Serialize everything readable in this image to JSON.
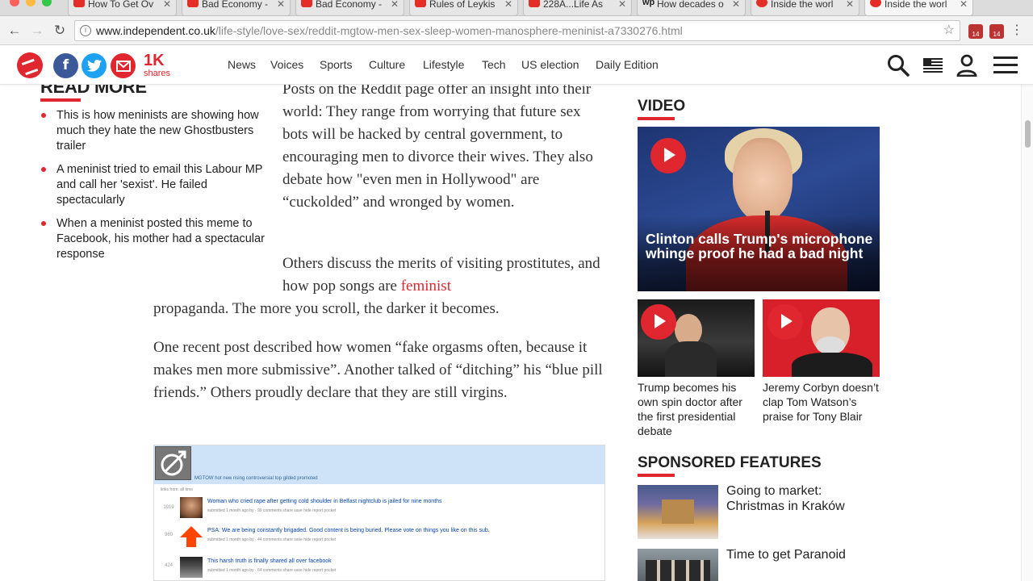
{
  "browser": {
    "tabs": [
      {
        "title": "How To Get Ov",
        "icon": "youtube-icon"
      },
      {
        "title": "Bad Economy -",
        "icon": "youtube-icon"
      },
      {
        "title": "Bad Economy -",
        "icon": "youtube-icon"
      },
      {
        "title": "Rules of Leykis",
        "icon": "youtube-icon"
      },
      {
        "title": "228A...Life As",
        "icon": "youtube-icon"
      },
      {
        "title": "How decades o",
        "icon": "wp-icon"
      },
      {
        "title": "Inside the worl",
        "icon": "independent-icon"
      },
      {
        "title": "Inside the worl",
        "icon": "independent-icon"
      }
    ],
    "url_domain": "www.independent.co.uk",
    "url_path": "/life-style/love-sex/reddit-mgtow-men-sex-sleep-women-manosphere-meninist-a7330276.html",
    "ext_badge_1": "14",
    "ext_badge_2": "14"
  },
  "header": {
    "share_count": "1K",
    "share_label": "shares",
    "facebook_glyph": "f",
    "nav": [
      "News",
      "Voices",
      "Sports",
      "Culture",
      "Lifestyle",
      "Tech",
      "US election",
      "Daily Edition"
    ]
  },
  "read_more": {
    "heading": "READ MORE",
    "items": [
      "This is how meninists are showing how much they hate the new Ghostbusters trailer",
      "A meninist tried to email this Labour MP and call her 'sexist'. He failed spectacularly",
      "When a meninist posted this meme to Facebook, his mother had a spectacular response"
    ]
  },
  "article": {
    "p1": "Posts on the Reddit page offer an insight into their world: They range from worrying that future sex bots will be hacked by central government, to encouraging men to divorce their wives. They also debate how \"even men in Hollywood\" are “cuckolded” and wronged by women.",
    "p2_before": "Others discuss the merits of visiting prostitutes, and how pop songs are ",
    "p2_link": "feminist",
    "p2_after": "propaganda. The more you scroll, the darker it becomes.",
    "p3": "One recent post described how women “fake orgasms often, because it makes men more submissive”. Another talked of “ditching” his “blue pill friends.” Others proudly declare that they are still virgins."
  },
  "embed": {
    "tabs": "MGTOW   hot   new   rising   controversial   top   gilded   promoted",
    "links_from": "links from: all time",
    "rows": [
      {
        "vote": "1919",
        "title": "Woman who cried rape after getting cold shoulder in Belfast nightclub is jailed for nine months",
        "meta": "submitted 1 month ago by  · 99 comments  share  save  hide  report  pocket"
      },
      {
        "vote": "960",
        "title": "PSA: We are being constantly brigaded. Good content is being buried. Please vote on things you like on this sub.",
        "meta": "submitted 1 month ago by  · 44 comments  share  save  hide  report  pocket"
      },
      {
        "vote": "424",
        "title": "This harsh truth is finally shared all over facebook",
        "meta": "submitted 1 month ago by  · 64 comments  share  save  hide  report  pocket"
      }
    ]
  },
  "sidebar": {
    "video_heading": "VIDEO",
    "main_video_caption": "Clinton calls Trump's microphone whinge proof he had a bad night",
    "small_videos": [
      {
        "caption": "Trump becomes his own spin doctor after the first presidential debate"
      },
      {
        "caption": "Jeremy Corbyn doesn’t clap Tom Watson’s praise for Tony Blair"
      }
    ],
    "sponsored_heading": "SPONSORED FEATURES",
    "sponsored": [
      {
        "title": "Going to market: Christmas in Kraków"
      },
      {
        "title": "Time to get Paranoid"
      }
    ]
  },
  "colors": {
    "brand_red": "#e0262f",
    "facebook": "#3b5998",
    "twitter": "#1da1f2",
    "email": "#e0262f"
  }
}
